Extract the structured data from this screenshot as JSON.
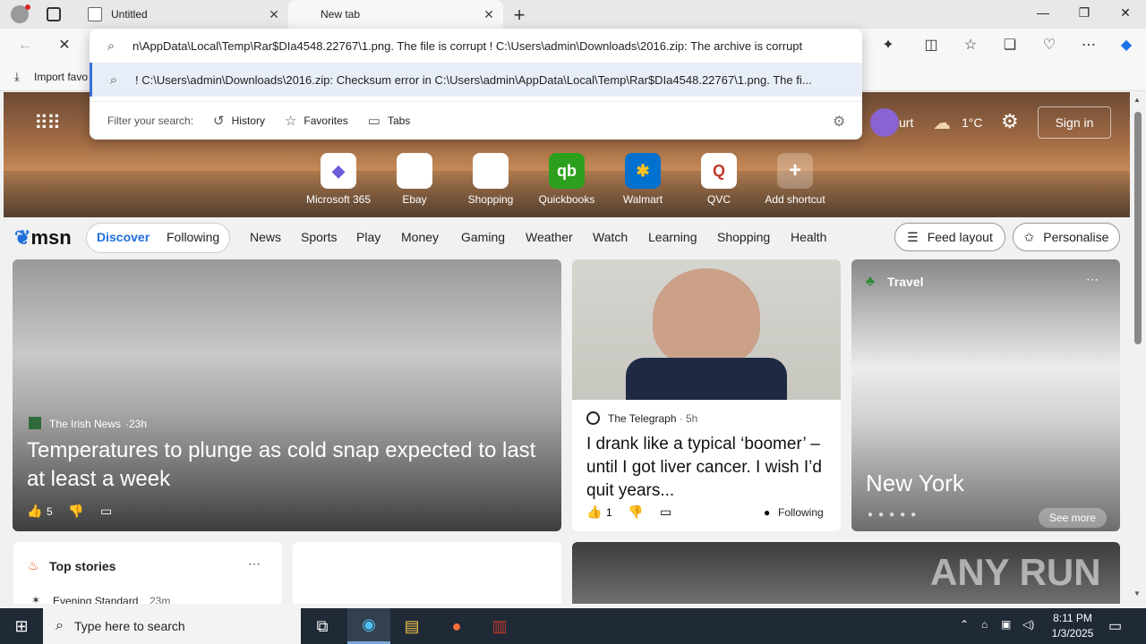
{
  "tabs": [
    {
      "label": "Untitled",
      "active": false
    },
    {
      "label": "New tab",
      "active": true
    }
  ],
  "omnibox": {
    "input_value": "n\\AppData\\Local\\Temp\\Rar$DIa4548.22767\\1.png. The file is corrupt ! C:\\Users\\admin\\Downloads\\2016.zip: The archive is corrupt",
    "suggestion": "! C:\\Users\\admin\\Downloads\\2016.zip: Checksum error in C:\\Users\\admin\\AppData\\Local\\Temp\\Rar$DIa4548.22767\\1.png. The fi...",
    "filter_label": "Filter your search:",
    "filters": [
      "History",
      "Favorites",
      "Tabs"
    ]
  },
  "favorites_bar": {
    "import_label": "Import favo"
  },
  "hero": {
    "weather_city": "urt",
    "temperature": "1°C",
    "signin_label": "Sign in",
    "shortcuts": [
      {
        "label": "Microsoft 365",
        "glyph": "◆",
        "color": "#6b5bd6"
      },
      {
        "label": "Ebay",
        "glyph": "▦",
        "color": "#333333"
      },
      {
        "label": "Shopping",
        "glyph": "◇",
        "color": "#333333"
      },
      {
        "label": "Quickbooks",
        "glyph": "qb",
        "color": "#2ca01c"
      },
      {
        "label": "Walmart",
        "glyph": "✱",
        "color": "#ffc220"
      },
      {
        "label": "QVC",
        "glyph": "Q",
        "color": "#c0392b"
      },
      {
        "label": "Add shortcut",
        "glyph": "+",
        "color": "#ffffff"
      }
    ]
  },
  "msn": {
    "logo": "msn",
    "feed_tabs": [
      "Discover",
      "Following"
    ],
    "nav": [
      "News",
      "Sports",
      "Play",
      "Money",
      "Gaming",
      "Weather",
      "Watch",
      "Learning",
      "Shopping",
      "Health"
    ],
    "feed_layout_label": "Feed layout",
    "personalise_label": "Personalise"
  },
  "cards": {
    "main": {
      "source": "The Irish News",
      "age": "23h",
      "headline": "Temperatures to plunge as cold snap expected to last at least a week",
      "likes": "5"
    },
    "mid": {
      "source": "The Telegraph",
      "age": "5h",
      "headline": "I drank like a typical ‘boomer’ – until I got liver cancer. I wish I’d quit years...",
      "likes": "1",
      "follow_label": "Following"
    },
    "travel": {
      "category": "Travel",
      "title": "New York",
      "see_more": "See more"
    },
    "top_stories": {
      "title": "Top stories",
      "source": "Evening Standard",
      "age": "23m"
    }
  },
  "watermark": "ANY RUN",
  "taskbar": {
    "search_placeholder": "Type here to search",
    "time": "8:11 PM",
    "date": "1/3/2025"
  }
}
